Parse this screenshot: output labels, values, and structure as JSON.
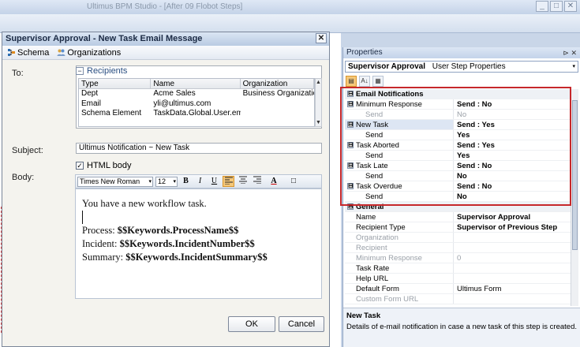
{
  "app": {
    "title": "Ultimus BPM Studio - [After 09 Flobot Steps]",
    "min": "_",
    "max": "□",
    "close": "✕"
  },
  "dialog": {
    "title": "Supervisor Approval - New Task Email Message",
    "close": "✕",
    "toolbar": {
      "schema": "Schema",
      "organizations": "Organizations"
    },
    "to_label": "To:",
    "recipients_title": "Recipients",
    "collapse": "−",
    "columns": [
      "Type",
      "Name",
      "Organization"
    ],
    "rows": [
      [
        "Dept",
        "Acme Sales",
        "Business Organization"
      ],
      [
        "Email",
        "yli@ultimus.com",
        ""
      ],
      [
        "Schema Element",
        "TaskData.Global.User.email",
        ""
      ]
    ],
    "scroll_up": "▲",
    "scroll_down": "▼",
    "subject_label": "Subject:",
    "subject": "Ultimus Notification ~ New Task",
    "html_body_checked": "✓",
    "html_body_label": "HTML body",
    "body_label": "Body:",
    "font": "Times New Roman",
    "font_size": "12",
    "dropdown_arrow": "▾",
    "format_buttons": {
      "bold": "B",
      "italic": "I",
      "underline": "U",
      "font_color": "A",
      "border": "□"
    },
    "body": {
      "line1": "You have a new workflow task.",
      "process_label": "Process: ",
      "process_value": "$$Keywords.ProcessName$$",
      "incident_label": "Incident: ",
      "incident_value": "$$Keywords.IncidentNumber$$",
      "summary_label": "Summary: ",
      "summary_value": "$$Keywords.IncidentSummary$$"
    },
    "ok": "OK",
    "cancel": "Cancel"
  },
  "properties": {
    "title": "Properties",
    "pin": "⊳ ✕",
    "object_name": "Supervisor Approval",
    "object_type": "User Step Properties",
    "toolbar": {
      "categorized": "▤",
      "alphabetical": "A↓",
      "pages": "▦"
    },
    "expand": "⊟",
    "email_section": "Email Notifications",
    "email": [
      {
        "name": "Minimum Response",
        "value": "Send : No",
        "send": "No",
        "send_gray": true
      },
      {
        "name": "New Task",
        "value": "Send : Yes",
        "send": "Yes",
        "send_gray": false
      },
      {
        "name": "Task Aborted",
        "value": "Send : Yes",
        "send": "Yes",
        "send_gray": false
      },
      {
        "name": "Task Late",
        "value": "Send : No",
        "send": "No",
        "send_gray": false
      },
      {
        "name": "Task Overdue",
        "value": "Send : No",
        "send": "No",
        "send_gray": false
      }
    ],
    "send_label": "Send",
    "general_section": "General",
    "general": [
      {
        "name": "Name",
        "value": "Supervisor Approval",
        "bold": true,
        "gray": false
      },
      {
        "name": "Recipient Type",
        "value": "Supervisor of Previous Step",
        "bold": true,
        "gray": false
      },
      {
        "name": "Organization",
        "value": "",
        "bold": false,
        "gray": true
      },
      {
        "name": "Recipient",
        "value": "",
        "bold": false,
        "gray": true
      },
      {
        "name": "Minimum Response",
        "value": "0",
        "bold": false,
        "gray": true
      },
      {
        "name": "Task Rate",
        "value": "",
        "bold": false,
        "gray": false
      },
      {
        "name": "Help URL",
        "value": "",
        "bold": false,
        "gray": false
      },
      {
        "name": "Default Form",
        "value": "Ultimus Form",
        "bold": false,
        "gray": false
      },
      {
        "name": "Custom Form URL",
        "value": "",
        "bold": false,
        "gray": true
      }
    ],
    "description_title": "New Task",
    "description": "Details of e-mail notification in case a new task of this step is created."
  },
  "colors": {
    "highlight_box": "#c6282b",
    "active_button": "#f5c87a"
  }
}
